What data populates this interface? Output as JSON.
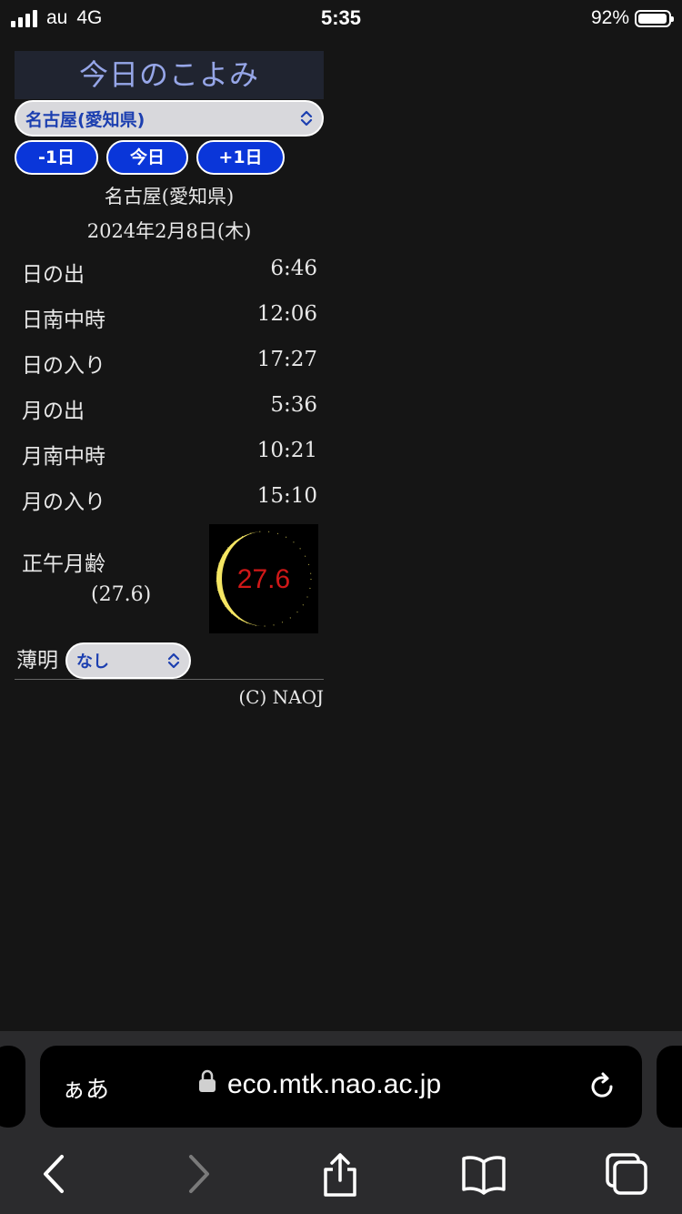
{
  "status_bar": {
    "carrier": "au",
    "network": "4G",
    "time": "5:35",
    "battery": "92%",
    "battery_level": 0.92
  },
  "page": {
    "title": "今日のこよみ",
    "location_select": "名古屋(愛知県)",
    "buttons": {
      "prev": "-1日",
      "today": "今日",
      "next": "+1日"
    },
    "location": "名古屋(愛知県)",
    "date": "2024年2月8日(木)",
    "times": [
      {
        "label": "日の出",
        "value": "6:46"
      },
      {
        "label": "日南中時",
        "value": "12:06"
      },
      {
        "label": "日の入り",
        "value": "17:27"
      },
      {
        "label": "月の出",
        "value": "5:36"
      },
      {
        "label": "月南中時",
        "value": "10:21"
      },
      {
        "label": "月の入り",
        "value": "15:10"
      }
    ],
    "moon_age_label": "正午月齢",
    "moon_age_value": "(27.6)",
    "moon_image_text": "27.6",
    "twilight_label": "薄明",
    "twilight_select": "なし",
    "copyright": "(C) NAOJ"
  },
  "browser": {
    "aa_label": "ぁあ",
    "url": "eco.mtk.nao.ac.jp"
  },
  "colors": {
    "title_bg": "#202430",
    "title_text": "#96a6e8",
    "button_blue": "#0a36d9",
    "select_text": "#1c3fb0",
    "moon_yellow": "#f5e663",
    "moon_text": "#d01818"
  }
}
